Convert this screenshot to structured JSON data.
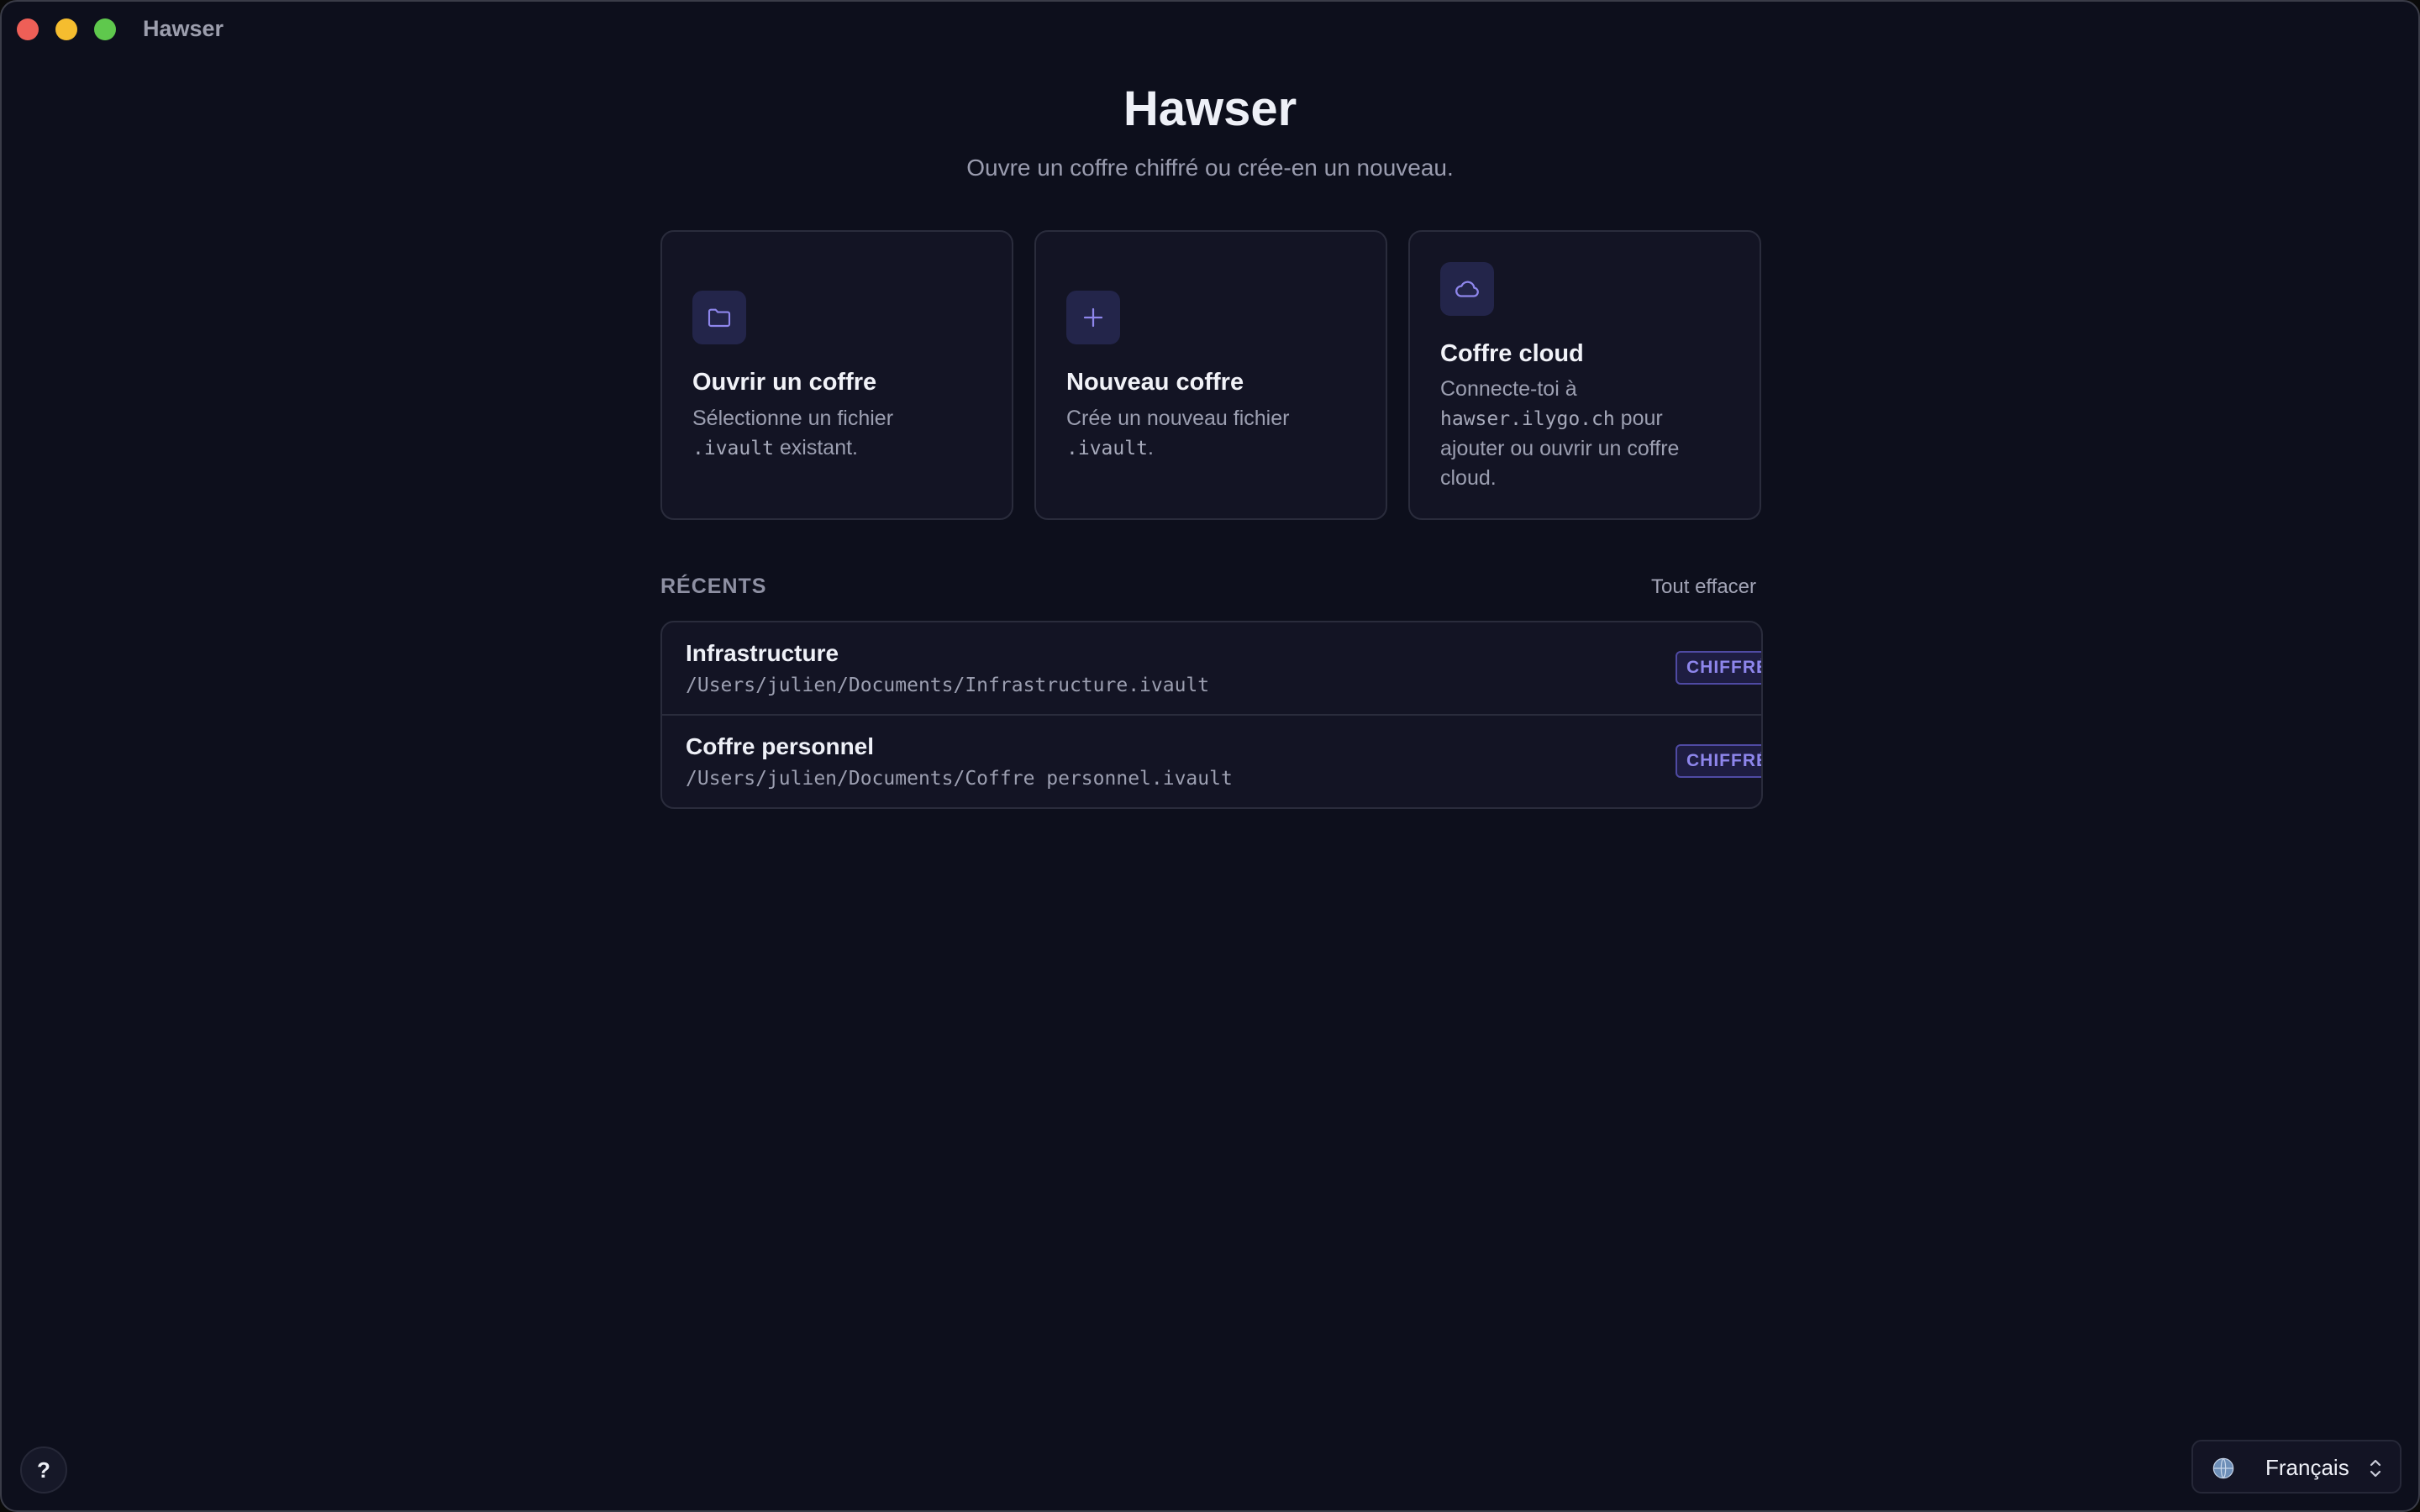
{
  "window": {
    "app_title": "Hawser"
  },
  "hero": {
    "title": "Hawser",
    "subtitle": "Ouvre un coffre chiffré ou crée-en un nouveau."
  },
  "actions": [
    {
      "icon": "folder-icon",
      "title": "Ouvrir un coffre",
      "desc_before": "Sélectionne un fichier ",
      "desc_code": ".ivault",
      "desc_after": " existant."
    },
    {
      "icon": "plus-icon",
      "title": "Nouveau coffre",
      "desc_before": "Crée un nouveau fichier ",
      "desc_code": ".ivault",
      "desc_after": "."
    },
    {
      "icon": "cloud-icon",
      "title": "Coffre cloud",
      "desc_before": "Connecte-toi à ",
      "desc_code": "hawser.ilygo.ch",
      "desc_after": " pour ajouter ou ouvrir un coffre cloud."
    }
  ],
  "recents": {
    "label": "RÉCENTS",
    "clear_label": "Tout effacer",
    "items": [
      {
        "name": "Infrastructure",
        "path": "/Users/julien/Documents/Infrastructure.ivault",
        "badge": "CHIFFRÉ"
      },
      {
        "name": "Coffre personnel",
        "path": "/Users/julien/Documents/Coffre personnel.ivault",
        "badge": "CHIFFRÉ"
      }
    ]
  },
  "footer": {
    "help_label": "?",
    "language": "Français",
    "language_icon": "globe-icon"
  },
  "colors": {
    "background": "#0d0f1c",
    "card": "#131424",
    "accent": "#8e86ec",
    "traffic_close": "#ee5f57",
    "traffic_minimize": "#f5bd2f",
    "traffic_maximize": "#5fc84d"
  }
}
